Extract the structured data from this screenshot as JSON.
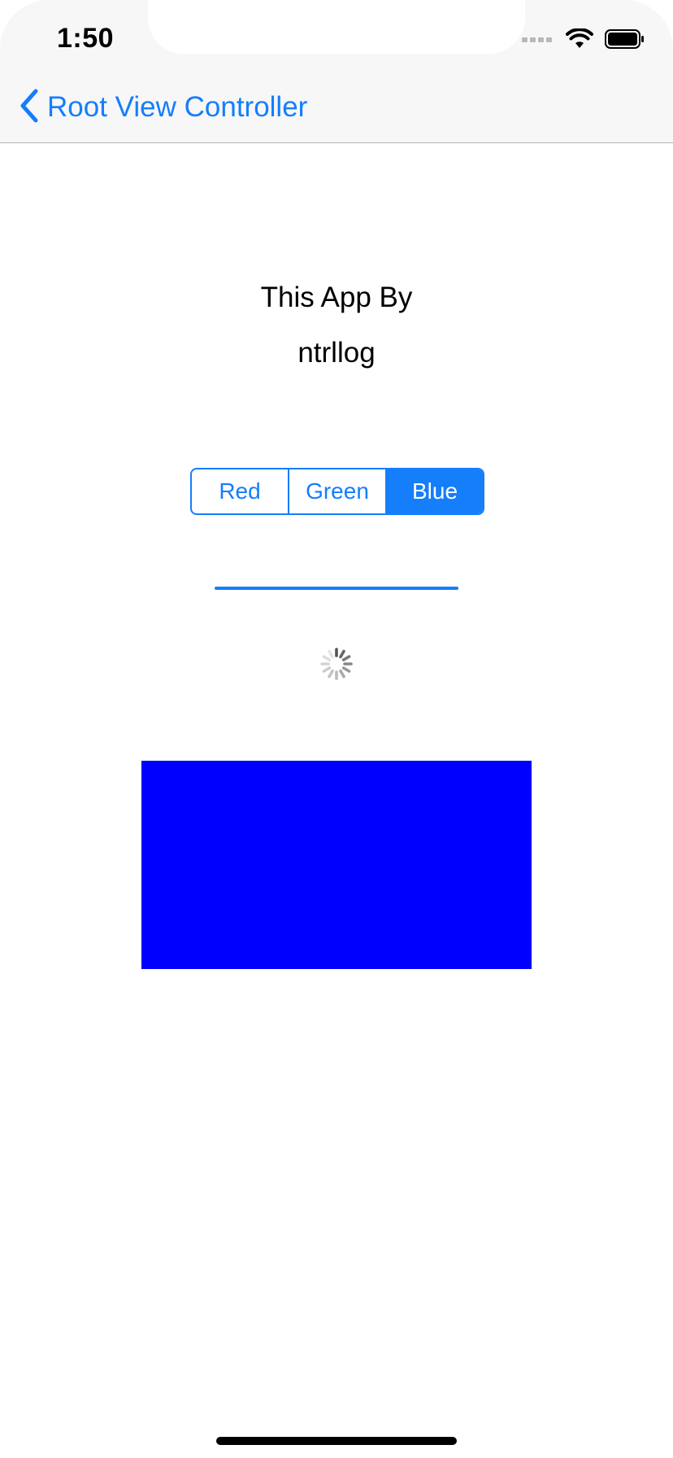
{
  "status_bar": {
    "time": "1:50",
    "icons": [
      "signal-icon",
      "wifi-icon",
      "battery-icon"
    ]
  },
  "nav": {
    "back_label": "Root View Controller",
    "back_icon": "chevron-left-icon"
  },
  "content": {
    "title_line1": "This App By",
    "title_line2": "ntrllog",
    "segments": [
      "Red",
      "Green",
      "Blue"
    ],
    "selected_segment": "Blue",
    "progress_fraction": 1.0,
    "activity_indicator": "spinner-icon",
    "color_box_color": "#0000ff"
  },
  "colors": {
    "accent": "#147efb",
    "nav_background": "#f7f7f7"
  }
}
